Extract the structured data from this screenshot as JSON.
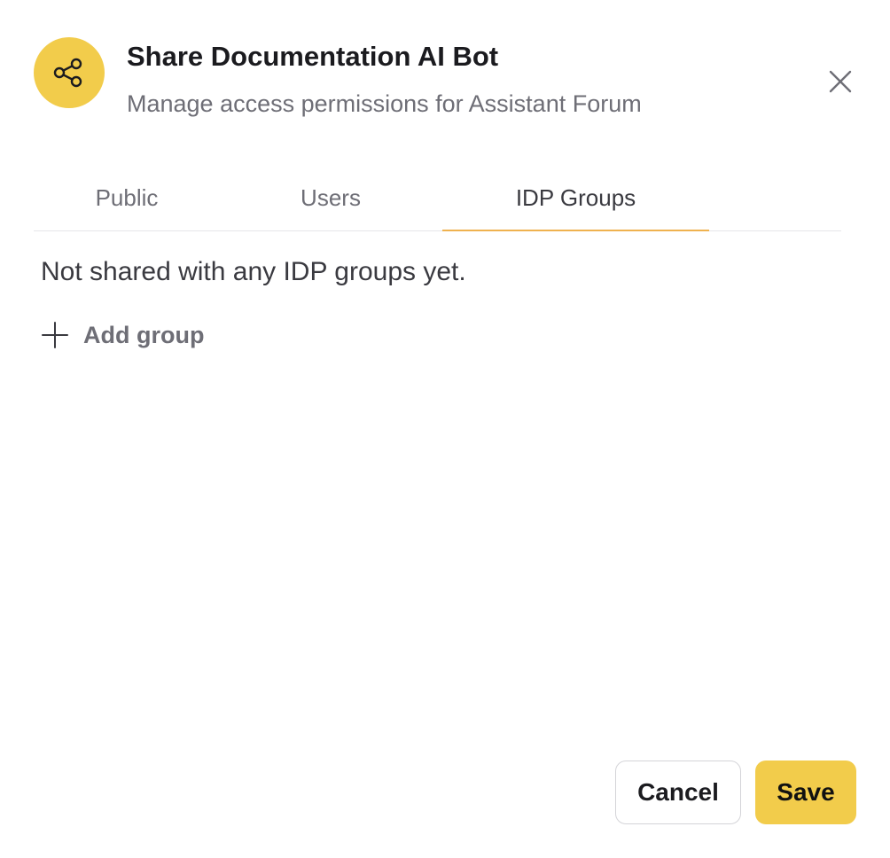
{
  "colors": {
    "accent": "#f2cc4b",
    "tab_indicator": "#efb24f"
  },
  "header": {
    "icon": "share-icon",
    "title": "Share Documentation AI Bot",
    "subtitle": "Manage access permissions for Assistant Forum",
    "close_icon": "close-icon"
  },
  "tabs": [
    {
      "label": "Public",
      "active": false
    },
    {
      "label": "Users",
      "active": false
    },
    {
      "label": "IDP Groups",
      "active": true
    }
  ],
  "content": {
    "empty_message": "Not shared with any IDP groups yet.",
    "add_group_icon": "plus-icon",
    "add_group_label": "Add group"
  },
  "footer": {
    "cancel_label": "Cancel",
    "save_label": "Save"
  }
}
